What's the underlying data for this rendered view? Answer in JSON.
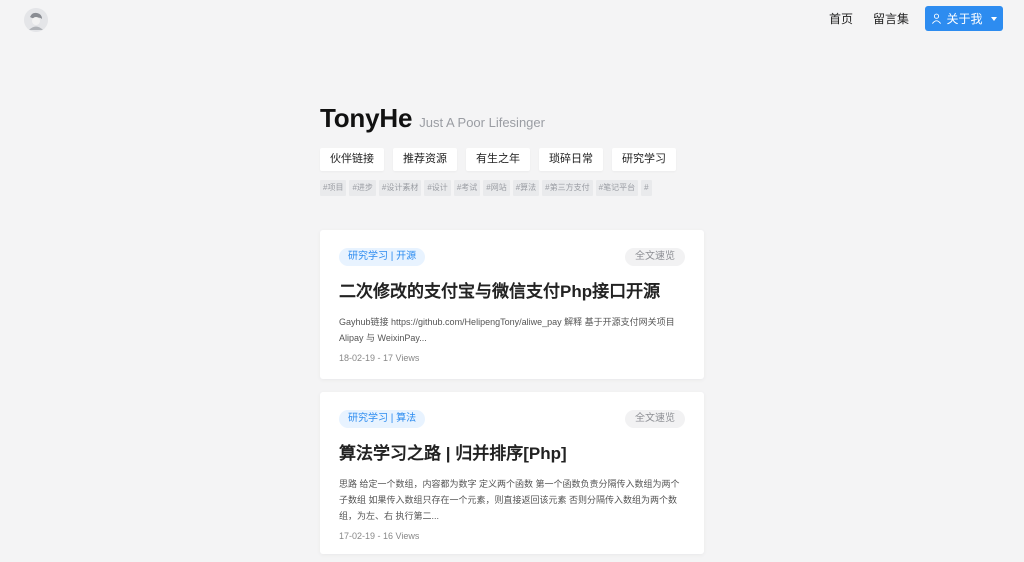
{
  "header": {
    "logo_icon": "avatar-logo",
    "nav": [
      {
        "label": "首页"
      },
      {
        "label": "留言集"
      }
    ],
    "about_button": {
      "label": "关于我",
      "icon": "user-icon"
    },
    "accent": "#2d8cf0"
  },
  "site": {
    "title": "TonyHe",
    "subtitle": "Just A Poor Lifesinger"
  },
  "categories": [
    "伙伴链接",
    "推荐资源",
    "有生之年",
    "琐碎日常",
    "研究学习"
  ],
  "tags": [
    "#项目",
    "#进步",
    "#设计素材",
    "#设计",
    "#考试",
    "#网站",
    "#算法",
    "#第三方支付",
    "#笔记平台",
    "#"
  ],
  "posts": [
    {
      "category": "研究学习 | 开源",
      "full_label": "全文速览",
      "title": "二次修改的支付宝与微信支付Php接口开源",
      "excerpt": "Gayhub链接 https://github.com/HelipengTony/aliwe_pay    解释 基于开源支付网关项目 Alipay 与 WeixinPay...",
      "date": "18-02-19",
      "views": "17 Views"
    },
    {
      "category": "研究学习 | 算法",
      "full_label": "全文速览",
      "title": "算法学习之路 | 归并排序[Php]",
      "excerpt": "思路 给定一个数组，内容都为数字 定义两个函数 第一个函数负责分隔传入数组为两个子数组 如果传入数组只存在一个元素，则直接返回该元素 否则分隔传入数组为两个数组，为左、右 执行第二...",
      "date": "17-02-19",
      "views": "16 Views"
    }
  ]
}
